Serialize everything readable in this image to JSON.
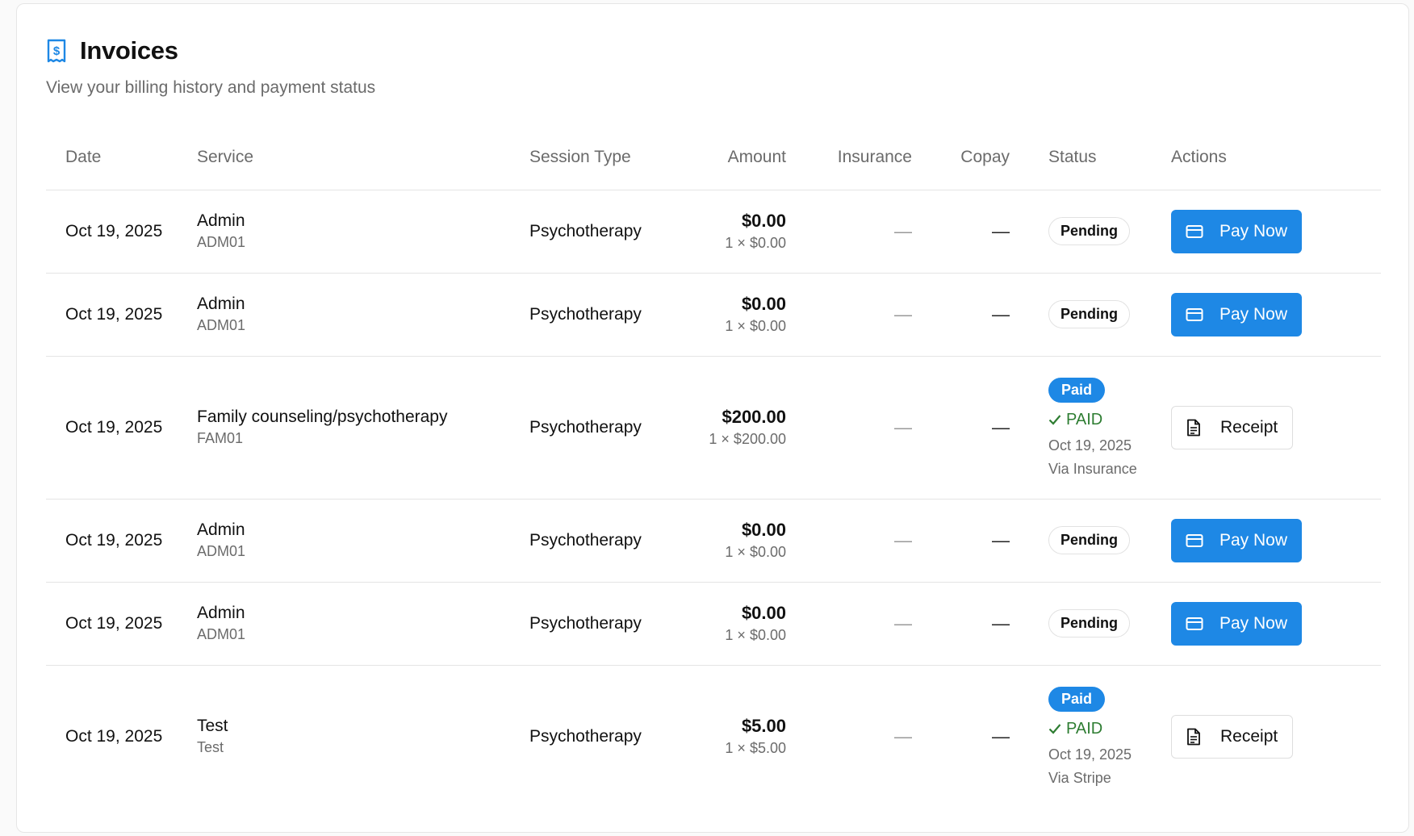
{
  "header": {
    "title": "Invoices",
    "subtitle": "View your billing history and payment status",
    "icon": "receipt-dollar-icon",
    "accent_color": "#1e88e5"
  },
  "table": {
    "columns": [
      "Date",
      "Service",
      "Session Type",
      "Amount",
      "Insurance",
      "Copay",
      "Status",
      "Actions"
    ],
    "rows": [
      {
        "date": "Oct 19, 2025",
        "service_name": "Admin",
        "service_code": "ADM01",
        "session_type": "Psychotherapy",
        "amount": "$0.00",
        "amount_detail": "1 × $0.00",
        "insurance": "—",
        "copay": "—",
        "status": "Pending",
        "action": "Pay Now"
      },
      {
        "date": "Oct 19, 2025",
        "service_name": "Admin",
        "service_code": "ADM01",
        "session_type": "Psychotherapy",
        "amount": "$0.00",
        "amount_detail": "1 × $0.00",
        "insurance": "—",
        "copay": "—",
        "status": "Pending",
        "action": "Pay Now"
      },
      {
        "date": "Oct 19, 2025",
        "service_name": "Family counseling/psychotherapy",
        "service_code": "FAM01",
        "session_type": "Psychotherapy",
        "amount": "$200.00",
        "amount_detail": "1 × $200.00",
        "insurance": "—",
        "copay": "—",
        "status": "Paid",
        "paid_label": "PAID",
        "paid_date": "Oct 19, 2025",
        "paid_via": "Via Insurance",
        "action": "Receipt"
      },
      {
        "date": "Oct 19, 2025",
        "service_name": "Admin",
        "service_code": "ADM01",
        "session_type": "Psychotherapy",
        "amount": "$0.00",
        "amount_detail": "1 × $0.00",
        "insurance": "—",
        "copay": "—",
        "status": "Pending",
        "action": "Pay Now"
      },
      {
        "date": "Oct 19, 2025",
        "service_name": "Admin",
        "service_code": "ADM01",
        "session_type": "Psychotherapy",
        "amount": "$0.00",
        "amount_detail": "1 × $0.00",
        "insurance": "—",
        "copay": "—",
        "status": "Pending",
        "action": "Pay Now"
      },
      {
        "date": "Oct 19, 2025",
        "service_name": "Test",
        "service_code": "Test",
        "session_type": "Psychotherapy",
        "amount": "$5.00",
        "amount_detail": "1 × $5.00",
        "insurance": "—",
        "copay": "—",
        "status": "Paid",
        "paid_label": "PAID",
        "paid_date": "Oct 19, 2025",
        "paid_via": "Via Stripe",
        "action": "Receipt"
      }
    ]
  },
  "colors": {
    "primary_button": "#1e88e5",
    "paid_badge": "#1e88e5",
    "paid_text": "#2e7d32"
  }
}
